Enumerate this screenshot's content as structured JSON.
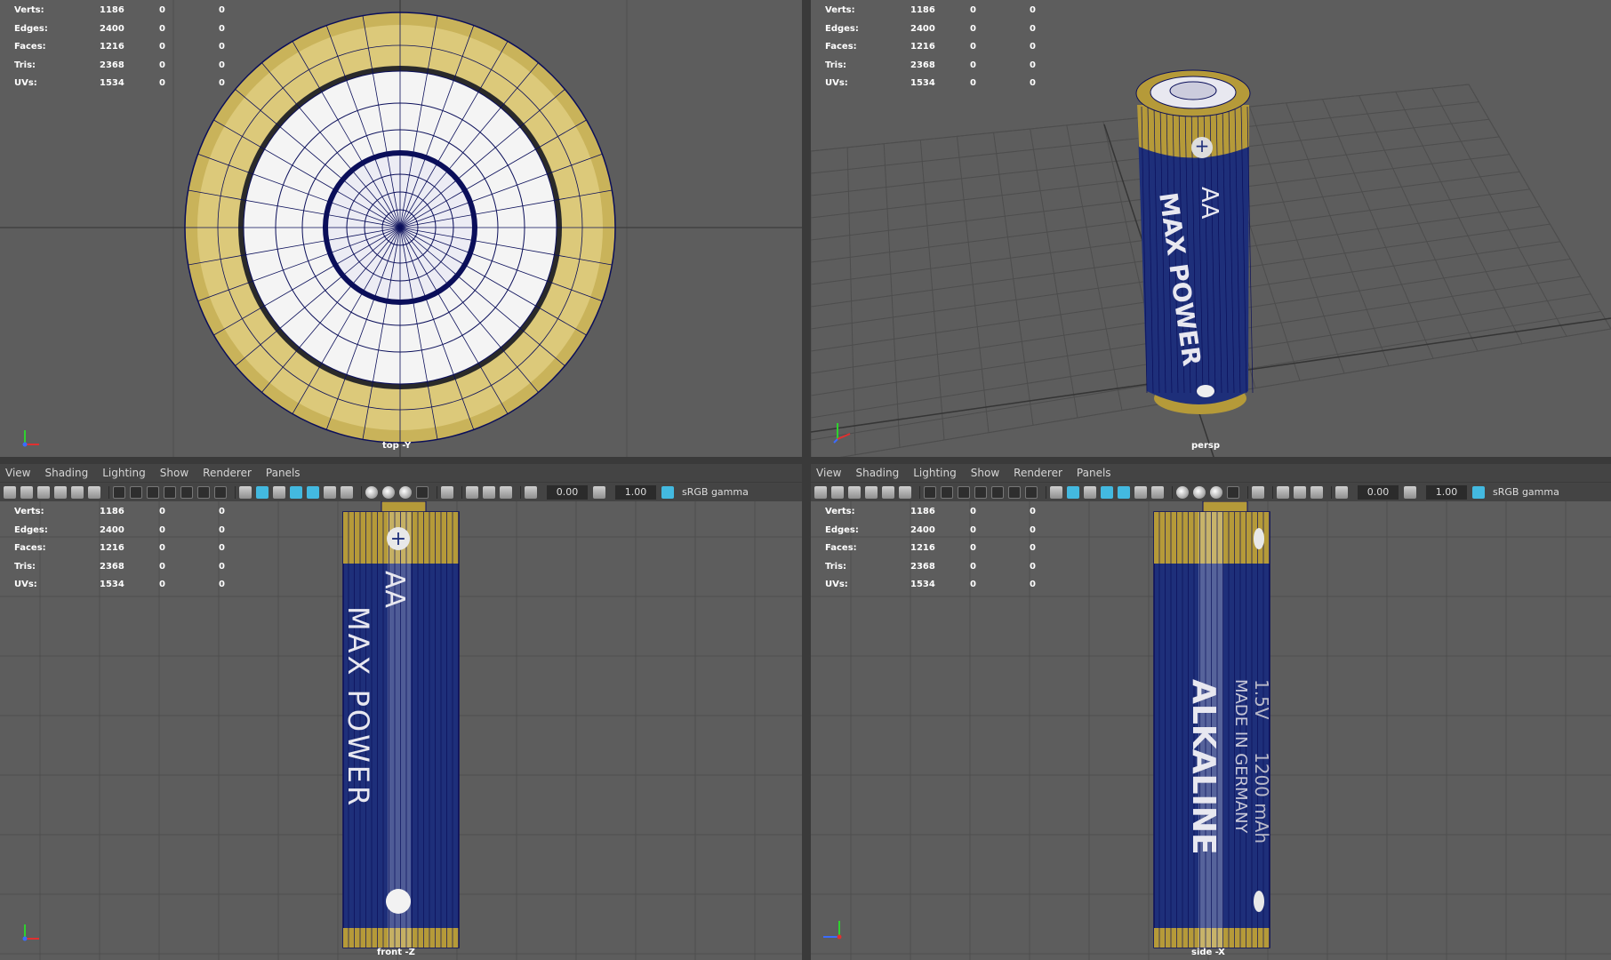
{
  "hud": {
    "rows": [
      {
        "label": "Verts:",
        "value": "1186",
        "v2": "0",
        "v3": "0"
      },
      {
        "label": "Edges:",
        "value": "2400",
        "v2": "0",
        "v3": "0"
      },
      {
        "label": "Faces:",
        "value": "1216",
        "v2": "0",
        "v3": "0"
      },
      {
        "label": "Tris:",
        "value": "2368",
        "v2": "0",
        "v3": "0"
      },
      {
        "label": "UVs:",
        "value": "1534",
        "v2": "0",
        "v3": "0"
      }
    ]
  },
  "menus": {
    "items": [
      "View",
      "Shading",
      "Lighting",
      "Show",
      "Renderer",
      "Panels"
    ]
  },
  "toolbar": {
    "exposure": "0.00",
    "gamma": "1.00",
    "colorspace": "sRGB gamma"
  },
  "cameras": {
    "top": "top -Y",
    "persp": "persp",
    "front": "front -Z",
    "side": "side -X"
  },
  "battery": {
    "size_label": "AA",
    "brand": "MAX POWER",
    "type": "ALKALINE",
    "voltage": "1.5V",
    "capacity": "1200 mAh",
    "origin": "MADE IN GERMANY",
    "plus": "+"
  },
  "colors": {
    "viewport_bg": "#5d5d5d",
    "grid": "#4f4f4f",
    "battery_blue": "#1e2f7a",
    "battery_gold": "#b59a39",
    "wire": "#0b0f5a",
    "accent": "#43b9e0"
  }
}
